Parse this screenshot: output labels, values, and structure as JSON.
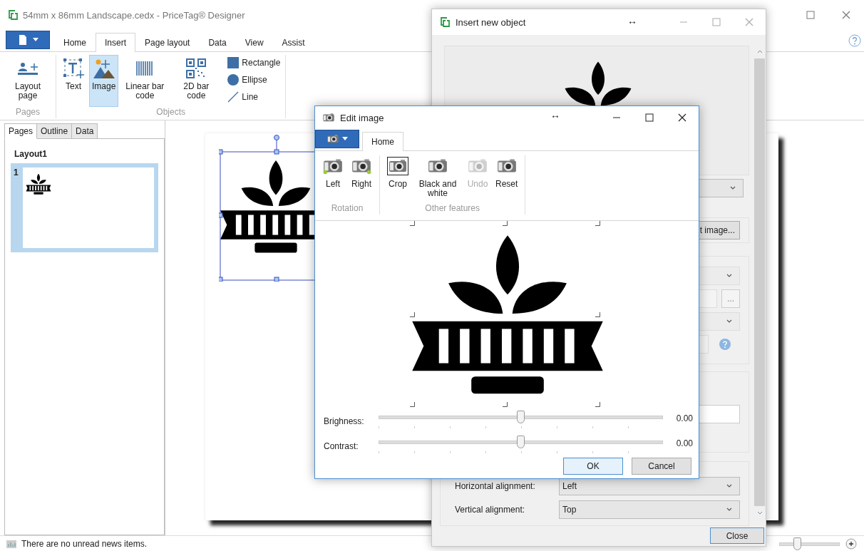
{
  "main_window": {
    "title": "54mm x 86mm Landscape.cedx - PriceTag® Designer",
    "tabs": [
      {
        "label": "Home",
        "selected": false
      },
      {
        "label": "Insert",
        "selected": true
      },
      {
        "label": "Page layout",
        "selected": false
      },
      {
        "label": "Data",
        "selected": false
      },
      {
        "label": "View",
        "selected": false
      },
      {
        "label": "Assist",
        "selected": false
      }
    ],
    "ribbon_groups": [
      {
        "label": "Pages",
        "items": [
          {
            "kind": "large",
            "label": "Layout page",
            "selected": false
          }
        ]
      },
      {
        "label": "Objects",
        "items": [
          {
            "kind": "large",
            "label": "Text",
            "selected": false
          },
          {
            "kind": "large",
            "label": "Image",
            "selected": true
          },
          {
            "kind": "large",
            "label": "Linear bar code",
            "selected": false
          },
          {
            "kind": "large",
            "label": "2D bar code",
            "selected": false
          },
          {
            "kind": "small",
            "label": "Rectangle",
            "selected": false
          },
          {
            "kind": "small",
            "label": "Ellipse",
            "selected": false
          },
          {
            "kind": "small",
            "label": "Line",
            "selected": false
          }
        ]
      }
    ],
    "panel_tabs": [
      {
        "label": "Pages",
        "selected": true
      },
      {
        "label": "Outline",
        "selected": false
      },
      {
        "label": "Data",
        "selected": false
      }
    ],
    "layout_name": "Layout1",
    "pages": [
      {
        "number": "1",
        "selected": true
      }
    ],
    "status_message": "There are no unread news items.",
    "zoom_slider": {
      "level": 0.3
    }
  },
  "insert_dialog": {
    "title": "Insert new object",
    "resize_mark": "↔",
    "top_dropdown": {
      "disabled": false
    },
    "sections": [
      {
        "controls": [
          {
            "kind": "button",
            "label": "t image..."
          }
        ]
      },
      {
        "controls": [
          {
            "kind": "dropdown",
            "disabled": true
          },
          {
            "kind": "browse",
            "disabled": true,
            "button": "..."
          },
          {
            "kind": "dropdown",
            "disabled": true
          },
          {
            "kind": "help",
            "disabled": true
          }
        ]
      },
      {
        "controls": [
          {
            "kind": "textbox",
            "disabled": false
          }
        ]
      }
    ],
    "alignments": [
      {
        "label": "Horizontal alignment:",
        "value": "Left"
      },
      {
        "label": "Vertical alignment:",
        "value": "Top"
      }
    ],
    "close_button": "Close"
  },
  "edit_image_dialog": {
    "title": "Edit image",
    "resize_mark": "↔",
    "tabs": [
      {
        "label": "Home",
        "selected": true
      }
    ],
    "groups": [
      {
        "label": "Rotation",
        "items": [
          {
            "label": "Left",
            "selected": false,
            "disabled": false
          },
          {
            "label": "Right",
            "selected": false,
            "disabled": false
          }
        ]
      },
      {
        "label": "Other features",
        "items": [
          {
            "label": "Crop",
            "selected": true,
            "disabled": false
          },
          {
            "label": "Black and white",
            "selected": false,
            "disabled": false
          },
          {
            "label": "Undo",
            "selected": false,
            "disabled": true
          },
          {
            "label": "Reset",
            "selected": false,
            "disabled": false
          }
        ]
      }
    ],
    "sliders": [
      {
        "label": "Brighness:",
        "level": 0.5,
        "reading": "0.00"
      },
      {
        "label": "Contrast:",
        "level": 0.5,
        "reading": "0.00"
      }
    ],
    "buttons": [
      {
        "label": "OK",
        "default": true
      },
      {
        "label": "Cancel",
        "default": false
      }
    ]
  }
}
